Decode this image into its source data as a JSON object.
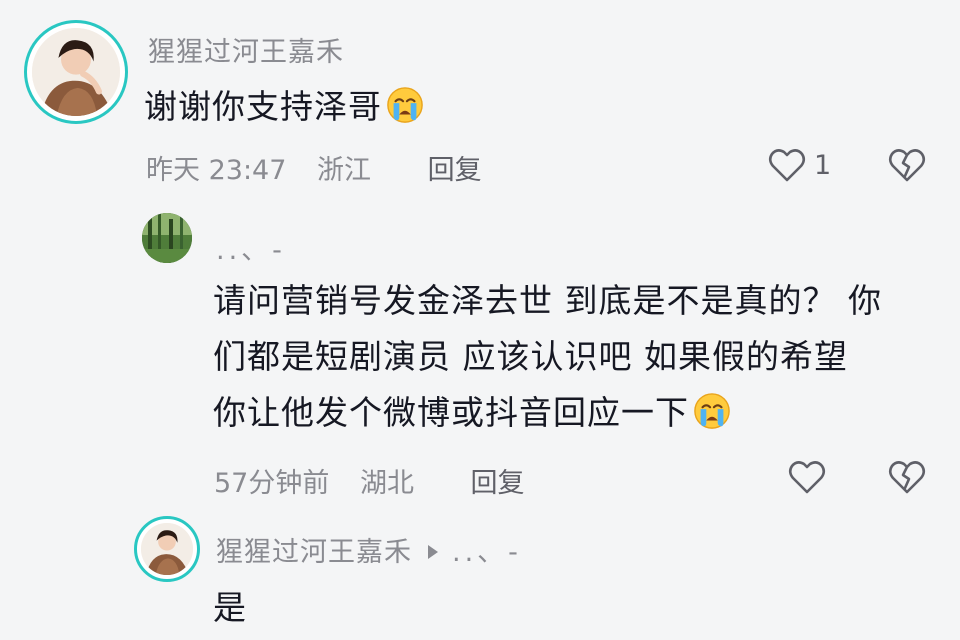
{
  "comments": [
    {
      "username": "猩猩过河王嘉禾",
      "text": "谢谢你支持泽哥",
      "emoji": "crying-face-icon",
      "time": "昨天 23:47",
      "location": "浙江",
      "reply_label": "回复",
      "like_count": "1"
    },
    {
      "username": "..、-",
      "text_lines": [
        "请问营销号发金泽去世 到底是不是真的？ 你",
        "们都是短剧演员 应该认识吧 如果假的希望",
        "你让他发个微博或抖音回应一下"
      ],
      "emoji": "crying-face-icon",
      "time": "57分钟前",
      "location": "湖北",
      "reply_label": "回复"
    },
    {
      "username": "猩猩过河王嘉禾",
      "reply_to": "..、-",
      "text": "是"
    }
  ],
  "icons": {
    "like": "heart-outline-icon",
    "dislike": "broken-heart-icon",
    "reply_arrow": "play-triangle-icon"
  },
  "colors": {
    "background": "#f4f5f6",
    "text_primary": "#161823",
    "text_secondary": "#8a8b91",
    "avatar_ring": "#29c7c2"
  }
}
